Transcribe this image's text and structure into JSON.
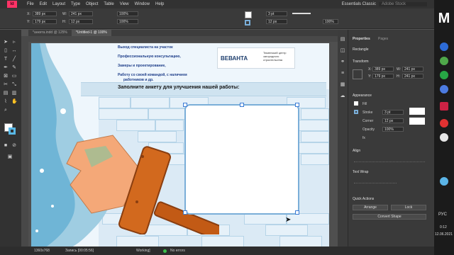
{
  "app": {
    "logo": "Id",
    "menu": [
      "File",
      "Edit",
      "Layout",
      "Type",
      "Object",
      "Table",
      "View",
      "Window",
      "Help"
    ],
    "workspace": "Essentials Classic",
    "search_placeholder": "Adobe Stock"
  },
  "control_bar": {
    "x": "389 px",
    "y": "179 px",
    "w": "241 px",
    "h": "12 px",
    "zoom": "100%",
    "stroke_pt": "3 pt",
    "corner": "12 px"
  },
  "tabs": [
    {
      "label": "*анкета.indd @ 125%"
    },
    {
      "label": "*Untitled-1 @ 100%"
    }
  ],
  "document": {
    "bullets": [
      "Выход специалиста на участок",
      "Профессиональную консультацию,",
      "Замеры и проектирование,",
      "Работу со своей командой, с наличием",
      "работников и др."
    ],
    "logo_text": "ВЕВАНТА",
    "logo_caption": "Тюменский центр загородного строительства",
    "banner": "Заполните анкету для улучшения нашей работы:"
  },
  "panel": {
    "tabs": [
      "Properties",
      "Pages"
    ],
    "object_type": "Rectangle",
    "transform_label": "Transform",
    "x": "389 px",
    "y": "179 px",
    "w": "241 px",
    "h": "241 px",
    "appearance_label": "Appearance",
    "fill_label": "Fill",
    "stroke_label": "Stroke",
    "stroke_value": "3 pt",
    "corner_label": "Corner",
    "corner_value": "12 px",
    "opacity_label": "Opacity",
    "opacity_value": "100%",
    "fx_label": "fx",
    "align_label": "Align",
    "text_wrap_label": "Text Wrap",
    "quick_actions_label": "Quick Actions",
    "arrange": "Arrange",
    "lock": "Lock",
    "convert_shape": "Convert Shape"
  },
  "status": {
    "view": "1360x768",
    "recording": "Запись [00:05:56]",
    "preflight": "Working]",
    "errors": "No errors"
  },
  "taskbar": {
    "lang": "РУС",
    "time": "0:12",
    "date": "12.06.2021"
  },
  "colors": {
    "accent_logo": "#ff3366",
    "brush_handle": "#d2691e",
    "bristles": "#f4a878",
    "water": "#9fcde2",
    "frame_stroke": "#7aaed8"
  }
}
